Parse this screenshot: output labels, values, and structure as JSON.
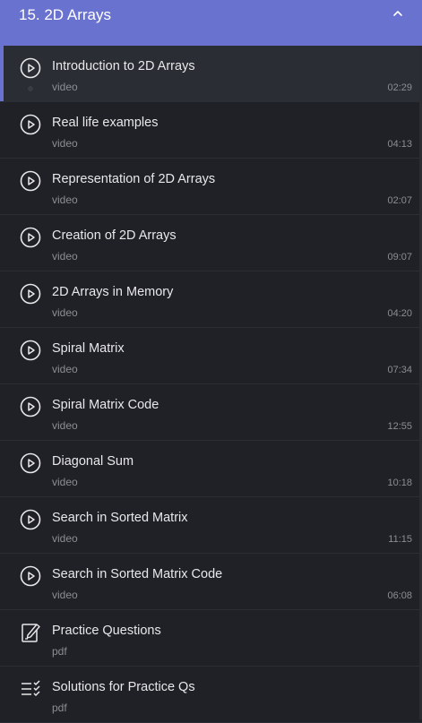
{
  "section": {
    "title": "15. 2D Arrays",
    "collapse_icon": "chevron-up-icon",
    "accent_color": "#6a72cf"
  },
  "items": [
    {
      "title": "Introduction to 2D Arrays",
      "type": "video",
      "duration": "02:29",
      "icon": "play-circle-icon",
      "active": true
    },
    {
      "title": "Real life examples",
      "type": "video",
      "duration": "04:13",
      "icon": "play-circle-icon"
    },
    {
      "title": "Representation of 2D Arrays",
      "type": "video",
      "duration": "02:07",
      "icon": "play-circle-icon"
    },
    {
      "title": "Creation of 2D Arrays",
      "type": "video",
      "duration": "09:07",
      "icon": "play-circle-icon"
    },
    {
      "title": "2D Arrays in Memory",
      "type": "video",
      "duration": "04:20",
      "icon": "play-circle-icon"
    },
    {
      "title": "Spiral Matrix",
      "type": "video",
      "duration": "07:34",
      "icon": "play-circle-icon"
    },
    {
      "title": "Spiral Matrix Code",
      "type": "video",
      "duration": "12:55",
      "icon": "play-circle-icon"
    },
    {
      "title": "Diagonal Sum",
      "type": "video",
      "duration": "10:18",
      "icon": "play-circle-icon"
    },
    {
      "title": "Search in Sorted Matrix",
      "type": "video",
      "duration": "11:15",
      "icon": "play-circle-icon"
    },
    {
      "title": "Search in Sorted Matrix Code",
      "type": "video",
      "duration": "06:08",
      "icon": "play-circle-icon"
    },
    {
      "title": "Practice Questions",
      "type": "pdf",
      "duration": "",
      "icon": "edit-document-icon"
    },
    {
      "title": "Solutions for Practice Qs",
      "type": "pdf",
      "duration": "",
      "icon": "checklist-icon"
    }
  ]
}
